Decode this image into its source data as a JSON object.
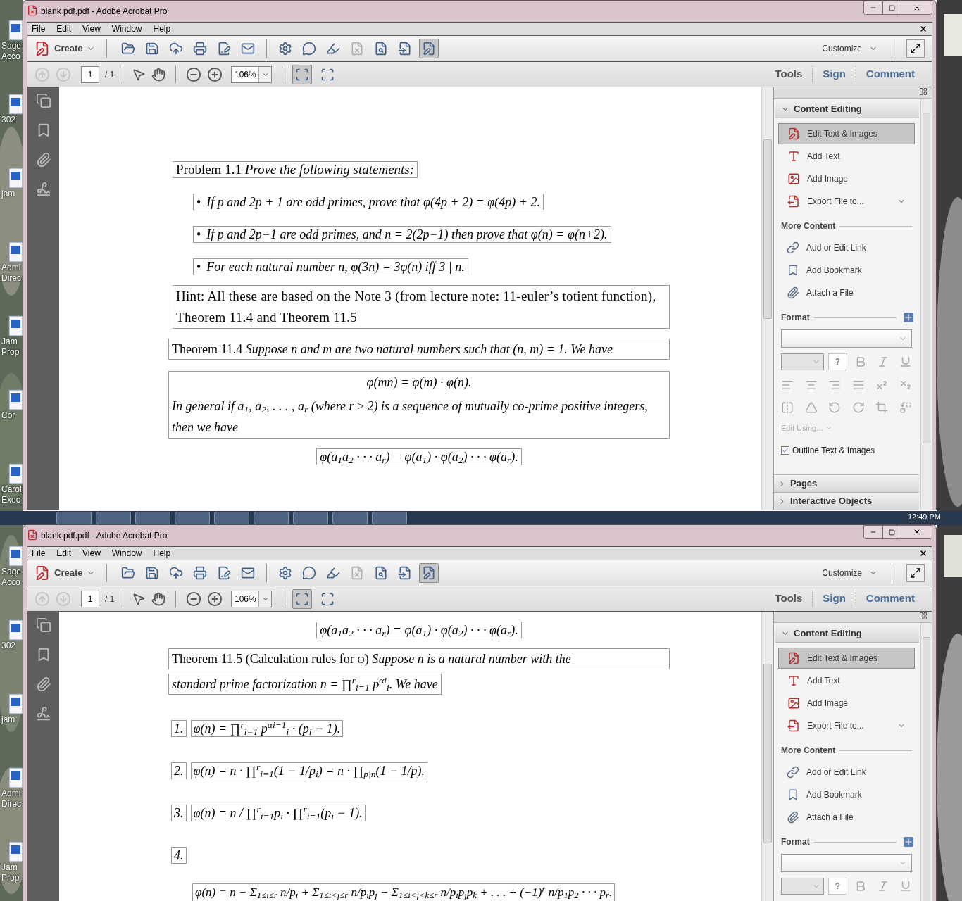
{
  "desktop": {
    "icons": [
      {
        "label": "Sage Acco"
      },
      {
        "label": "302"
      },
      {
        "label": "jam"
      },
      {
        "label": "Admi Direc"
      },
      {
        "label": "Jam Prop"
      },
      {
        "label": "Cor"
      },
      {
        "label": "Carol Exec"
      }
    ],
    "icons_lower": [
      {
        "label": "Sage Acco"
      },
      {
        "label": "302"
      },
      {
        "label": "jam"
      },
      {
        "label": "Admi Direc"
      },
      {
        "label": "Jam Prop"
      }
    ],
    "taskbar": {
      "clock": "12:49 PM"
    }
  },
  "windows": [
    {
      "title": "blank pdf.pdf - Adobe Acrobat Pro",
      "menu": [
        "File",
        "Edit",
        "View",
        "Window",
        "Help"
      ],
      "create": "Create",
      "customize": "Customize",
      "page": "1",
      "page_total": "/ 1",
      "zoom": "106%",
      "task_tabs": [
        {
          "label": "Tools",
          "selected": true
        },
        {
          "label": "Sign",
          "selected": false
        },
        {
          "label": "Comment",
          "selected": false
        }
      ],
      "document": {
        "blocks": [
          {
            "kind": "heading",
            "label": "Problem 1.1",
            "text": "Prove the following statements:"
          },
          {
            "kind": "bullet",
            "marker": "•",
            "text": "If p and 2p + 1 are odd primes, prove that φ(4p + 2) = φ(4p) + 2."
          },
          {
            "kind": "bullet",
            "marker": "•",
            "text": "If p and 2p−1 are odd primes, and n = 2(2p−1) then prove that φ(n) = φ(n+2)."
          },
          {
            "kind": "bullet",
            "marker": "•",
            "text": "For each natural number n, φ(3n) = 3φ(n) iff 3 | n."
          },
          {
            "kind": "hint",
            "text": "Hint: All these are based on the Note 3 (from lecture note: 11-euler’s totient function), Theorem 11.4 and Theorem 11.5"
          },
          {
            "kind": "theorem",
            "label": "Theorem 11.4",
            "text": "Suppose n and m are two natural numbers such that (n, m) = 1. We have"
          },
          {
            "kind": "formula_box",
            "formula": "φ(mn) = φ(m) · φ(n).",
            "text": "In general if a$_{1}$, a$_{2}$, . . . , a$_{r}$ (where r ≥ 2) is a sequence of mutually co-prime positive integers, then we have"
          },
          {
            "kind": "formula",
            "text": "φ(a$_{1}$a$_{2}$ · · · a$_{r}$) = φ(a$_{1}$) · φ(a$_{2}$) · · · φ(a$_{r}$)."
          }
        ]
      },
      "panel": {
        "content_editing": {
          "title": "Content Editing",
          "expanded": true,
          "items": [
            {
              "label": "Edit Text & Images",
              "selected": true
            },
            {
              "label": "Add Text",
              "selected": false
            },
            {
              "label": "Add Image",
              "selected": false
            },
            {
              "label": "Export File to...",
              "selected": false
            }
          ]
        },
        "more_content": {
          "title": "More Content",
          "items": [
            {
              "label": "Add or Edit Link"
            },
            {
              "label": "Add Bookmark"
            },
            {
              "label": "Attach a File"
            }
          ]
        },
        "format": {
          "title": "Format",
          "help": "?",
          "edit_using": "Edit Using...",
          "outline": {
            "label": "Outline Text & Images",
            "checked": true
          }
        },
        "sections": [
          {
            "title": "Pages",
            "expanded": false
          },
          {
            "title": "Interactive Objects",
            "expanded": false
          }
        ]
      }
    },
    {
      "title": "blank pdf.pdf - Adobe Acrobat Pro",
      "menu": [
        "File",
        "Edit",
        "View",
        "Window",
        "Help"
      ],
      "create": "Create",
      "customize": "Customize",
      "page": "1",
      "page_total": "/ 1",
      "zoom": "106%",
      "task_tabs": [
        {
          "label": "Tools",
          "selected": true
        },
        {
          "label": "Sign",
          "selected": false
        },
        {
          "label": "Comment",
          "selected": false
        }
      ],
      "document": {
        "blocks": [
          {
            "kind": "formula",
            "text": "φ(a$_{1}$a$_{2}$ · · · a$_{r}$) = φ(a$_{1}$) · φ(a$_{2}$) · · · φ(a$_{r}$)."
          },
          {
            "kind": "theorem",
            "label": "Theorem 11.5 (Calculation rules for φ)",
            "text": "Suppose n is a natural number with the"
          },
          {
            "kind": "line",
            "text": "standard prime factorization n = ∏$^{r}$$_{i=1}$ p$^{αi}$$_{i}$. We have"
          },
          {
            "kind": "numbered",
            "number": "1.",
            "text": "φ(n) = ∏$^{r}$$_{i=1}$ p$^{αi−1}$$_{i}$ · (p$_{i}$ − 1)."
          },
          {
            "kind": "numbered",
            "number": "2.",
            "text": "φ(n) = n · ∏$^{r}$$_{i=1}$(1 − 1/p$_{i}$) = n · ∏$_{p|n}$(1 − 1/p)."
          },
          {
            "kind": "numbered",
            "number": "3.",
            "text": "φ(n) = n / ∏$^{r}$$_{i=1}$p$_{i}$ · ∏$^{r}$$_{i=1}$(p$_{i}$ − 1)."
          },
          {
            "kind": "numbered",
            "number": "4."
          },
          {
            "kind": "display",
            "text": "φ(n) = n − Σ$_{1≤i≤r}$ n/p$_{i}$ + Σ$_{1≤i<j≤r}$ n/p$_{i}$p$_{j}$ − Σ$_{1≤i<j<k≤r}$ n/p$_{i}$p$_{j}$p$_{k}$ + . . . + (−1)$^{r}$ n/p$_{1}$p$_{2}$ · · · p$_{r}$."
          }
        ]
      },
      "panel": {
        "content_editing": {
          "title": "Content Editing",
          "expanded": true,
          "items": [
            {
              "label": "Edit Text & Images",
              "selected": true
            },
            {
              "label": "Add Text",
              "selected": false
            },
            {
              "label": "Add Image",
              "selected": false
            },
            {
              "label": "Export File to...",
              "selected": false
            }
          ]
        },
        "more_content": {
          "title": "More Content",
          "items": [
            {
              "label": "Add or Edit Link"
            },
            {
              "label": "Add Bookmark"
            },
            {
              "label": "Attach a File"
            }
          ]
        },
        "format": {
          "title": "Format",
          "help": "?"
        }
      }
    }
  ]
}
